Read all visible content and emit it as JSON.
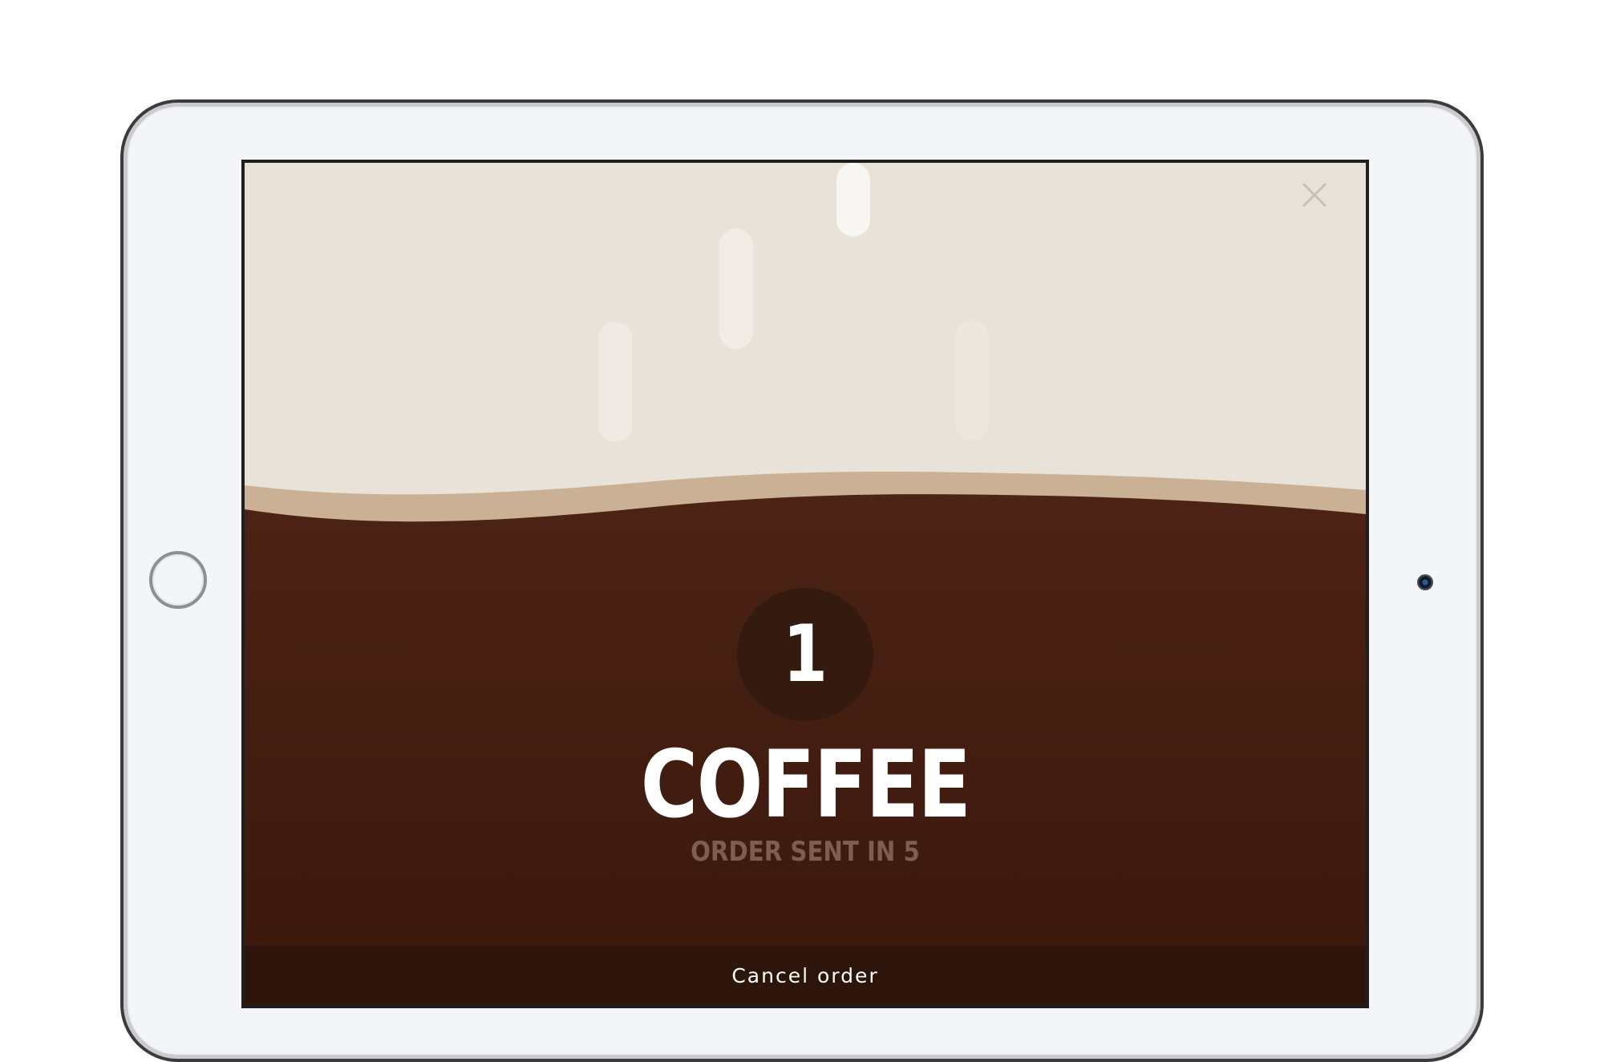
{
  "order": {
    "quantity": "1",
    "item_name": "COFFEE",
    "status": "ORDER SENT IN 5"
  },
  "actions": {
    "cancel_label": "Cancel order"
  },
  "icons": {
    "close": "close-icon",
    "home": "home-button"
  },
  "colors": {
    "foam": "#e9e2d8",
    "crema": "#cab095",
    "coffee_top": "#4c2315",
    "coffee_bottom": "#3a170c",
    "count_circle": "#351a10",
    "cancel_bar": "#2e150b",
    "status_text": "#7d5e51"
  }
}
